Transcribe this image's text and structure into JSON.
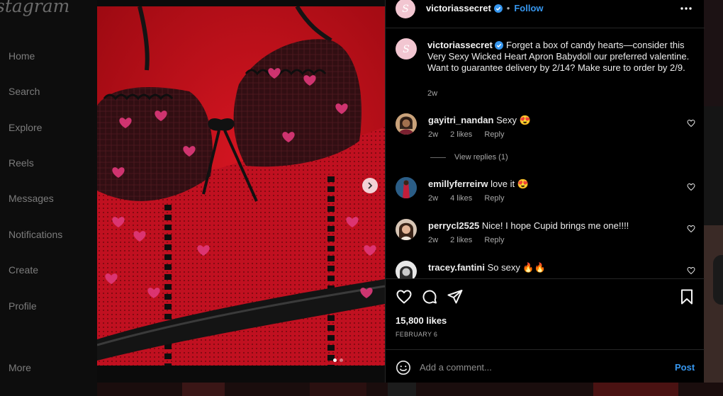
{
  "app": {
    "logo_text": "stagram"
  },
  "sidebar": {
    "items": [
      {
        "label": "Home"
      },
      {
        "label": "Search"
      },
      {
        "label": "Explore"
      },
      {
        "label": "Reels"
      },
      {
        "label": "Messages"
      },
      {
        "label": "Notifications"
      },
      {
        "label": "Create"
      },
      {
        "label": "Profile"
      }
    ],
    "more_label": "More"
  },
  "post": {
    "image": {
      "carousel_count": 2,
      "active_index": 0
    },
    "header": {
      "username": "victoriassecret",
      "separator": "•",
      "follow_label": "Follow"
    },
    "caption": {
      "username": "victoriassecret",
      "text": "Forget a box of candy hearts—consider this Very Sexy Wicked Heart Apron Babydoll our preferred valentine. Want to guarantee delivery by 2/14? Make sure to order by 2/9.",
      "time": "2w"
    },
    "comments": [
      {
        "username": "gayitri_nandan",
        "text": "Sexy 😍",
        "time": "2w",
        "likes": "2 likes",
        "reply_label": "Reply"
      },
      {
        "username": "emillyferreirw",
        "text": "love it 😍",
        "time": "2w",
        "likes": "4 likes",
        "reply_label": "Reply"
      },
      {
        "username": "perrycl2525",
        "text": "Nice! I hope Cupid brings me one!!!!",
        "time": "2w",
        "likes": "2 likes",
        "reply_label": "Reply"
      },
      {
        "username": "tracey.fantini",
        "text": "So sexy 🔥🔥"
      }
    ],
    "view_replies_label": "View replies (1)",
    "likes_count": "15,800 likes",
    "date": "FEBRUARY 6",
    "add_comment": {
      "placeholder": "Add a comment...",
      "post_label": "Post"
    }
  },
  "colors": {
    "accent": "#3797ef",
    "panel_bg": "#000000",
    "border": "#262626",
    "verified": "#3797ef"
  },
  "icons": [
    "verified-badge-icon",
    "more-options-icon",
    "heart-icon",
    "comment-icon",
    "share-icon",
    "bookmark-icon",
    "emoji-icon",
    "chevron-right-icon"
  ]
}
